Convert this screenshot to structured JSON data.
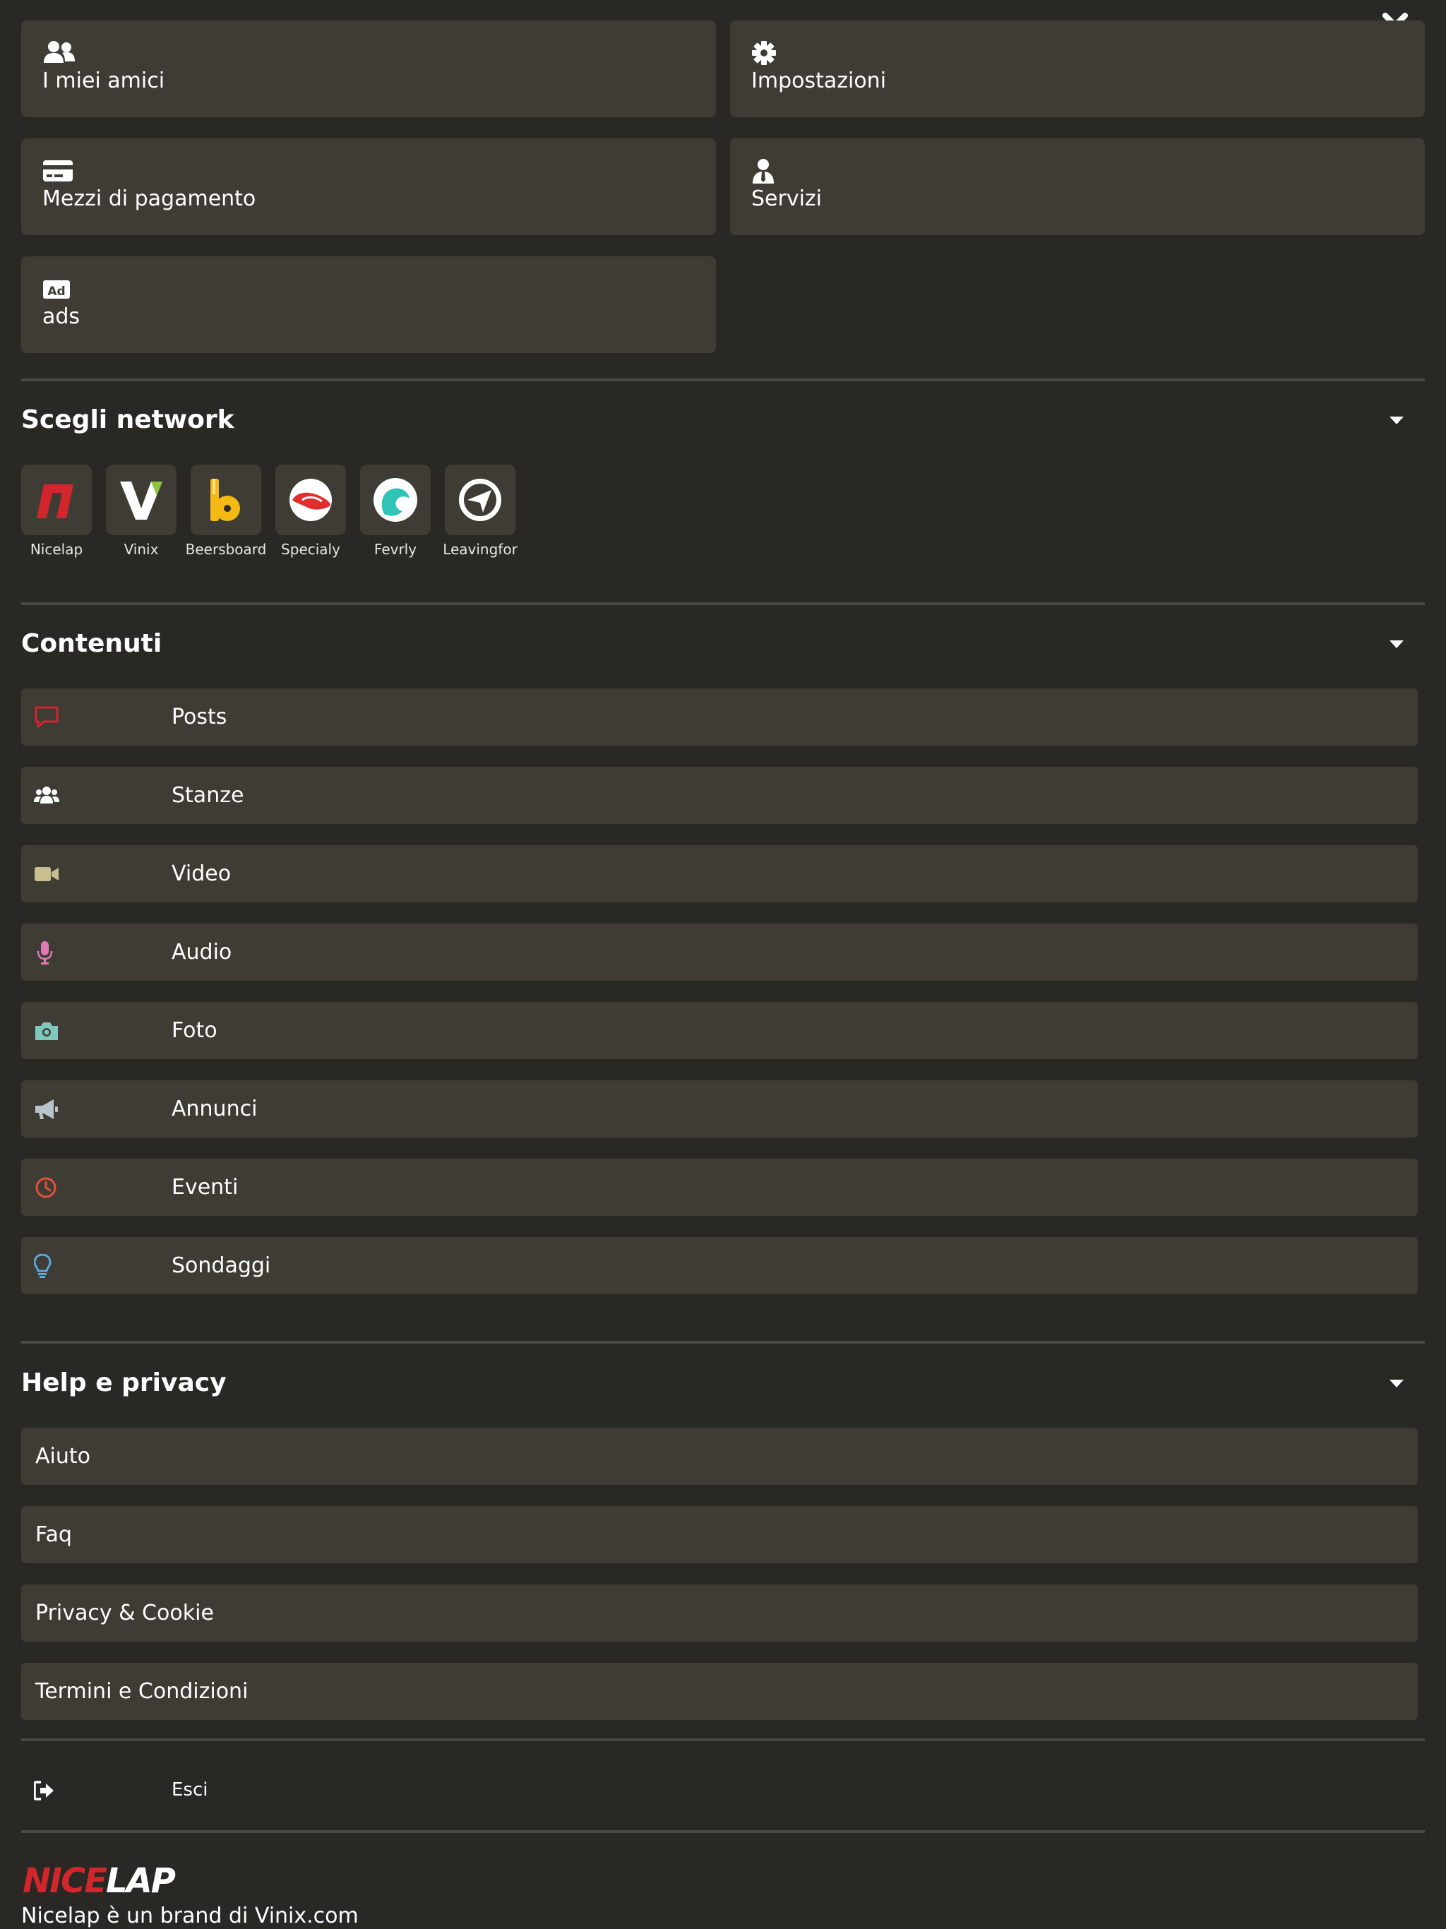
{
  "quick_links": [
    {
      "label": "I miei amici",
      "icon": "users-icon"
    },
    {
      "label": "Impostazioni",
      "icon": "gear-icon"
    },
    {
      "label": "Mezzi di pagamento",
      "icon": "credit-card-icon"
    },
    {
      "label": "Servizi",
      "icon": "user-tie-icon"
    },
    {
      "label": "ads",
      "icon": "ad-icon"
    }
  ],
  "networks": {
    "title": "Scegli network",
    "items": [
      {
        "label": "Nicelap",
        "icon": "nicelap-logo-icon",
        "color": "#d1262c"
      },
      {
        "label": "Vinix",
        "icon": "vinix-logo-icon",
        "color": "#8cc63f"
      },
      {
        "label": "Beersboard",
        "icon": "beersboard-logo-icon",
        "color": "#f5b915"
      },
      {
        "label": "Specialy",
        "icon": "specialy-logo-icon",
        "color": "#e02d2d"
      },
      {
        "label": "Fevrly",
        "icon": "fevrly-logo-icon",
        "color": "#2ec4b6"
      },
      {
        "label": "Leavingfor",
        "icon": "leavingfor-logo-icon",
        "color": "#ffffff"
      }
    ]
  },
  "contents": {
    "title": "Contenuti",
    "items": [
      {
        "label": "Posts",
        "icon": "comment-icon",
        "color": "#d1262c"
      },
      {
        "label": "Stanze",
        "icon": "group-icon",
        "color": "#ffffff"
      },
      {
        "label": "Video",
        "icon": "video-camera-icon",
        "color": "#c8c08c"
      },
      {
        "label": "Audio",
        "icon": "microphone-icon",
        "color": "#e07ab6"
      },
      {
        "label": "Foto",
        "icon": "camera-icon",
        "color": "#7fc8be"
      },
      {
        "label": "Annunci",
        "icon": "megaphone-icon",
        "color": "#b8c4cc"
      },
      {
        "label": "Eventi",
        "icon": "clock-icon",
        "color": "#e0523a"
      },
      {
        "label": "Sondaggi",
        "icon": "lightbulb-icon",
        "color": "#5aa8e0"
      }
    ]
  },
  "help": {
    "title": "Help e privacy",
    "items": [
      {
        "label": "Aiuto"
      },
      {
        "label": "Faq"
      },
      {
        "label": "Privacy & Cookie"
      },
      {
        "label": "Termini e Condizioni"
      }
    ]
  },
  "logout": {
    "label": "Esci",
    "icon": "sign-out-icon"
  },
  "footer": {
    "logo_text": "NICELAP",
    "note": "Nicelap è un brand di Vinix.com"
  }
}
